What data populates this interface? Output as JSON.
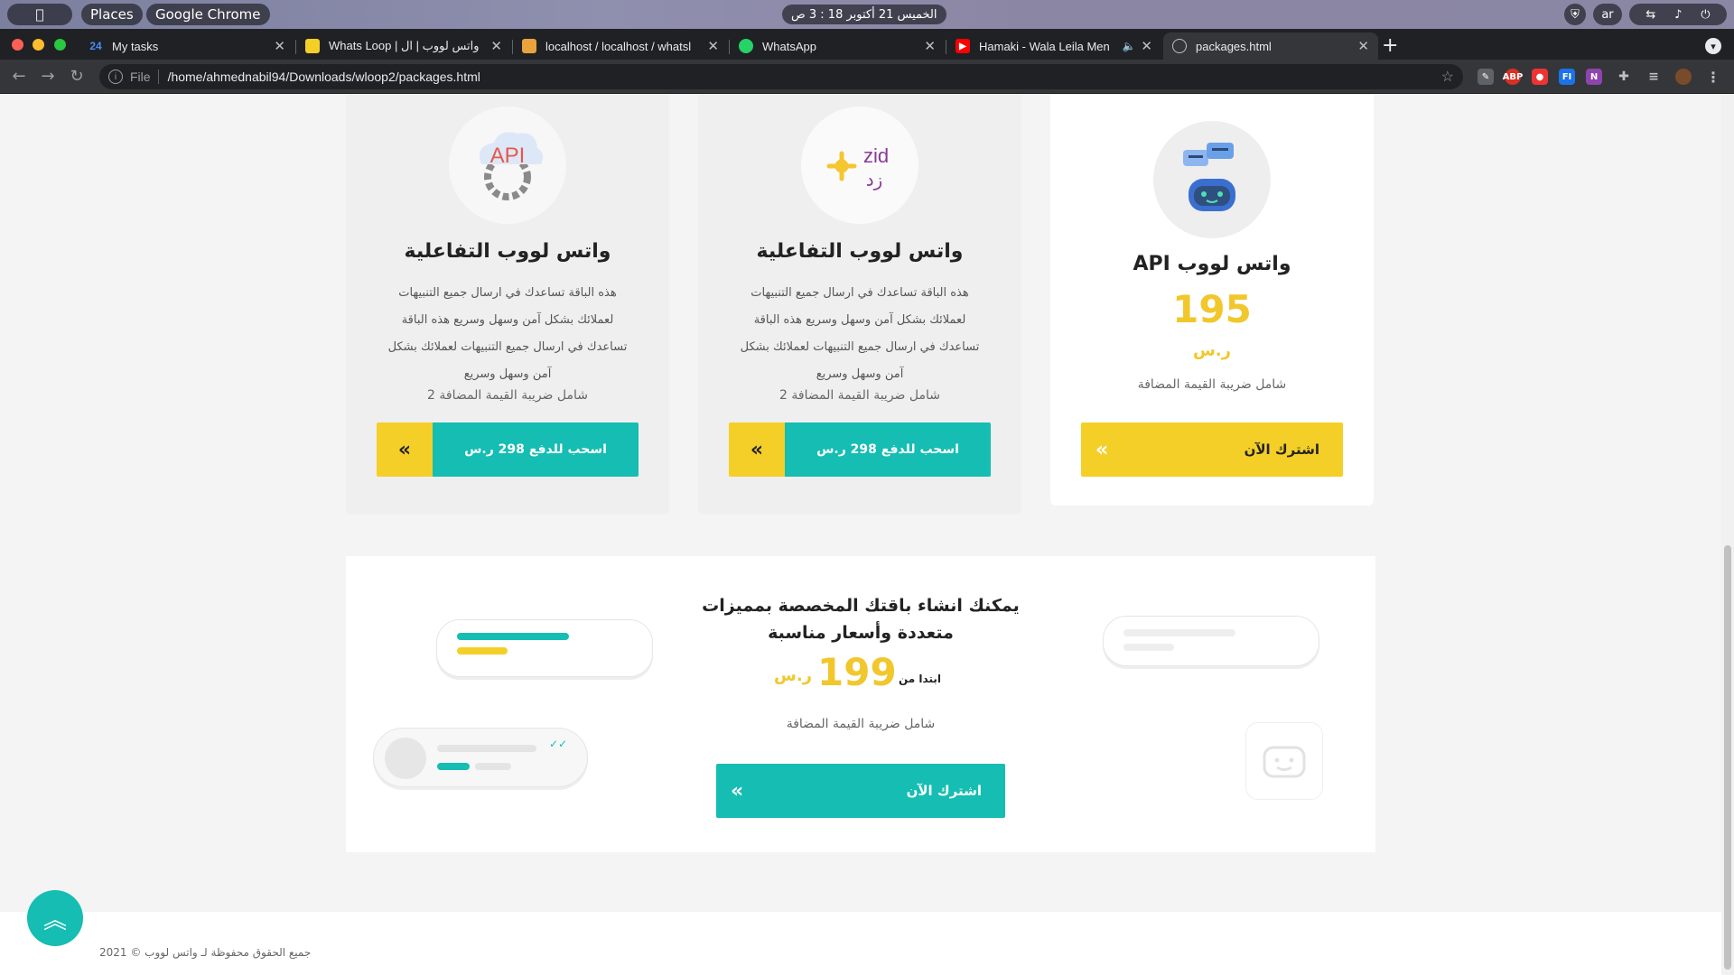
{
  "os": {
    "places": "Places",
    "app": "Google Chrome",
    "clock": "الخميس 21 أكتوبر  18 : 3 ص",
    "lang": "ar"
  },
  "browser": {
    "tabs": [
      {
        "title": "My tasks",
        "icon": "24"
      },
      {
        "title": "Whats Loop | واتس لووب | ال",
        "icon": ""
      },
      {
        "title": "localhost / localhost / whatsl",
        "icon": ""
      },
      {
        "title": "WhatsApp",
        "icon": ""
      },
      {
        "title": "Hamaki - Wala Leila Men",
        "icon": ""
      },
      {
        "title": "packages.html",
        "icon": ""
      }
    ],
    "url_scheme": "File",
    "url": "/home/ahmednabil94/Downloads/wloop2/packages.html"
  },
  "colors": {
    "accent": "#15bdb3",
    "yellow": "#f4cf28",
    "price": "#f1c72b"
  },
  "cards": [
    {
      "icon": "api-gear-icon",
      "icon_text": "API",
      "title": "واتس لووب التفاعلية",
      "desc": "هذه الباقة تساعدك في ارسال جميع التنبيهات لعملائك بشكل آمن وسهل وسريع هذه الباقة تساعدك في ارسال جميع التنبيهات لعملائك بشكل آمن وسهل وسريع",
      "vat": "شامل ضريبة القيمة المضافة 2",
      "button": "اسحب للدفع 298 ر.س"
    },
    {
      "icon": "zid-icon",
      "icon_text": "zid",
      "icon_text2": "زد",
      "title": "واتس لووب التفاعلية",
      "desc": "هذه الباقة تساعدك في ارسال جميع التنبيهات لعملائك بشكل آمن وسهل وسريع هذه الباقة تساعدك في ارسال جميع التنبيهات لعملائك بشكل آمن وسهل وسريع",
      "vat": "شامل ضريبة القيمة المضافة 2",
      "button": "اسحب للدفع 298 ر.س"
    },
    {
      "icon": "chatbot-icon",
      "title": "واتس لووب API",
      "price": "195",
      "currency": "ر.س",
      "vat": "شامل ضريبة القيمة المضافة",
      "button": "اشترك الآن"
    }
  ],
  "custom": {
    "title": "يمكنك انشاء باقتك المخصصة بمميزات متعددة وأسعار مناسبة",
    "from": "ابتدا من",
    "price": "199",
    "currency": "ر.س",
    "vat": "شامل ضريبة القيمة المضافة",
    "button": "اشترك الآن"
  },
  "footer": {
    "copyright": "جميع الحقوق محفوظة لـ واتس لووب © 2021"
  }
}
